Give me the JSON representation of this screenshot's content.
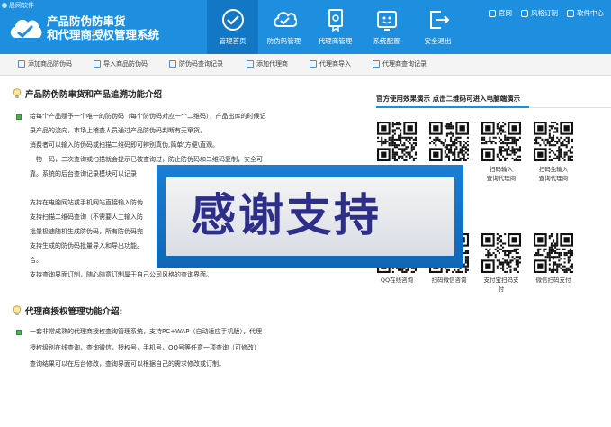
{
  "header": {
    "brand_small": "晨网软件",
    "title_line1": "产品防伪防串货",
    "title_line2": "和代理商授权管理系统",
    "nav": [
      {
        "label": "管理首页",
        "icon": "check-circle-icon",
        "active": true
      },
      {
        "label": "防伪码管理",
        "icon": "cloud-check-icon",
        "active": false
      },
      {
        "label": "代理商管理",
        "icon": "certificate-icon",
        "active": false
      },
      {
        "label": "系统配置",
        "icon": "settings-box-icon",
        "active": false
      },
      {
        "label": "安全退出",
        "icon": "logout-icon",
        "active": false
      }
    ],
    "toplinks": [
      "官网",
      "风格订制",
      "软件中心"
    ]
  },
  "toolbar": [
    "添加商品防伪码",
    "导入商品防伪码",
    "防伪码查询记录",
    "添加代理商",
    "代理商导入",
    "代理商查询记录"
  ],
  "section1": {
    "title": "产品防伪防串货和产品追溯功能介绍",
    "lines": [
      "给每个产品赋予一个唯一的防伪码（每个防伪码对应一个二维码），产品出库的时候记",
      "录产品的流向，市场上稽查人员通过产品防伪码判断有无窜货。",
      "消费者可以输入防伪码或扫描二维码即可辨别真伪,简单\\方便\\直观。",
      "一物一码，二次查询或扫描就会提示已被查询过，防止防伪码和二维码复制，安全可",
      "靠。系统的后台查询记录模块可以记录",
      "",
      "支持在电脑网站或手机网站直接输入防伪",
      "支持扫描二维码查询（不需要人工输入防",
      "批量极速随机生成防伪码，所有防伪码完",
      "支持生成的防伪码批量导入和导出功能。",
      "合。",
      "支持查询界面订制，随心随意订制属于自己公司风格的查询界面。"
    ]
  },
  "section2": {
    "title": "代理商授权管理功能介绍:",
    "lines": [
      "一套非常成熟的代理商授权查询管理系统，支持PC+WAP（自动适应手机版），代理",
      "授权级别在线查询，查询微信，授权号，手机号，QQ号等任意一项查询（可修改）",
      "查询结果可以在后台修改，查询界面可以根据自己的需求修改或订制。"
    ]
  },
  "demo": {
    "title": "官方使用效果演示 点击二维码可进入电脑端演示",
    "row1_captions": [
      "",
      "",
      "扫码输入\n查询代理商",
      "扫码免输入\n查询代理商"
    ],
    "row1_captions_vis": [
      "",
      "",
      "扫码输入",
      "扫码免输入"
    ],
    "row1_captions_vis2": [
      "",
      "",
      "查询代理商",
      "查询代理商"
    ],
    "row2_captions": [
      "QQ在线咨询",
      "扫码微信咨询",
      "支付宝扫码支",
      "微信扫码支付"
    ],
    "row2_caption_extra": "付"
  },
  "banner": {
    "text": "感谢支持"
  },
  "colors": {
    "header_bg": "#1d8fde",
    "nav_active": "#1278c5",
    "banner_bg": "#1a7ed2",
    "banner_text": "#2d2e8a"
  }
}
